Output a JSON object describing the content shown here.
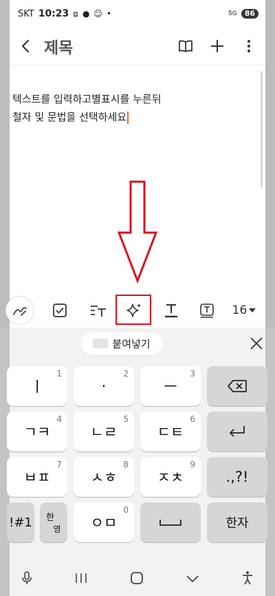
{
  "status_bar": {
    "carrier": "SKT",
    "time": "10:23",
    "network": "5G",
    "battery": "86"
  },
  "app_bar": {
    "title": "제목"
  },
  "editor": {
    "line1": "텍스트를 입력하고별표시를 누른뒤",
    "line2": "철자 및 문법을 선택하세요"
  },
  "toolbar": {
    "font_size": "16"
  },
  "keyboard": {
    "paste_label": "붙여넣기",
    "keys": [
      {
        "main": "ㅣ",
        "hint": "1"
      },
      {
        "main": "·",
        "hint": "2"
      },
      {
        "main": "ㅡ",
        "hint": "3"
      },
      {
        "main": "ㄱㅋ",
        "hint": "4"
      },
      {
        "main": "ㄴㄹ",
        "hint": "5"
      },
      {
        "main": "ㄷㅌ",
        "hint": "6"
      },
      {
        "main": "ㅂㅍ",
        "hint": "7"
      },
      {
        "main": "ㅅㅎ",
        "hint": "8"
      },
      {
        "main": "ㅈㅊ",
        "hint": "9"
      },
      {
        "main": "ㅇㅁ",
        "hint": "0"
      }
    ],
    "punct": ".,?!",
    "symbols": "!#1",
    "lang_top": "한",
    "lang_bottom": "영",
    "hanja": "한자"
  },
  "colors": {
    "highlight": "#d8101f",
    "caret": "#e36a2b"
  }
}
